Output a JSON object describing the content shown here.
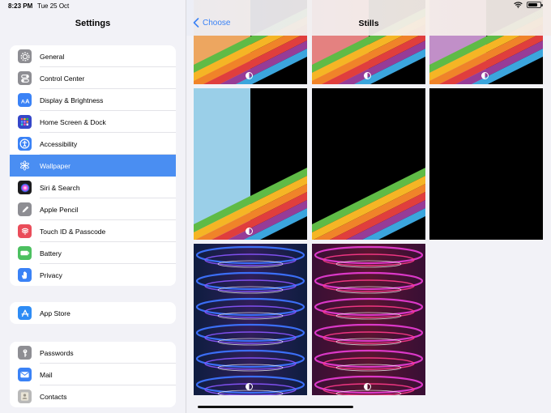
{
  "status_bar": {
    "time": "8:23 PM",
    "date": "Tue 25 Oct",
    "battery_level": 0.75
  },
  "sidebar": {
    "title": "Settings",
    "group1": [
      {
        "label": "General",
        "icon": "gear-icon",
        "color": "#8e8e93"
      },
      {
        "label": "Control Center",
        "icon": "switches-icon",
        "color": "#8e8e93"
      },
      {
        "label": "Display & Brightness",
        "icon": "text-size-icon",
        "color": "#3a82f6"
      },
      {
        "label": "Home Screen & Dock",
        "icon": "app-grid-icon",
        "color": "#3547c9"
      },
      {
        "label": "Accessibility",
        "icon": "accessibility-person-icon",
        "color": "#3a82f6"
      },
      {
        "label": "Wallpaper",
        "icon": "flower-icon",
        "color": "#4a8ef2",
        "selected": true
      },
      {
        "label": "Siri & Search",
        "icon": "siri-icon",
        "color": "#1c1c1e"
      },
      {
        "label": "Apple Pencil",
        "icon": "pencil-icon",
        "color": "#8e8e93"
      },
      {
        "label": "Touch ID & Passcode",
        "icon": "fingerprint-icon",
        "color": "#ea4d5a"
      },
      {
        "label": "Battery",
        "icon": "battery-icon",
        "color": "#4cc060"
      },
      {
        "label": "Privacy",
        "icon": "hand-icon",
        "color": "#3a82f6"
      }
    ],
    "group2": [
      {
        "label": "App Store",
        "icon": "app-store-icon",
        "color": "#2e8cf5"
      }
    ],
    "group3": [
      {
        "label": "Passwords",
        "icon": "key-icon",
        "color": "#8e8e93"
      },
      {
        "label": "Mail",
        "icon": "envelope-icon",
        "color": "#3a82f6"
      },
      {
        "label": "Contacts",
        "icon": "contacts-icon",
        "color": "#b9b9b9"
      }
    ]
  },
  "detail": {
    "back_label": "Choose",
    "title": "Stills",
    "accent": "#3a82f6",
    "wallpapers": [
      {
        "name": "Classic Stripes Orange",
        "style": "stripes",
        "bg": "#eda660",
        "appearance_toggle": true
      },
      {
        "name": "Classic Stripes Pink",
        "style": "stripes",
        "bg": "#e48180",
        "appearance_toggle": true
      },
      {
        "name": "Classic Stripes Purple",
        "style": "stripes",
        "bg": "#c18fc8",
        "appearance_toggle": true
      },
      {
        "name": "Classic Stripes Blue",
        "style": "stripes",
        "bg": "#9acfe8",
        "appearance_toggle": true
      },
      {
        "name": "Classic Stripes Black",
        "style": "stripes",
        "bg": "#000000",
        "appearance_toggle": false
      },
      {
        "name": "Black",
        "style": "solid",
        "bg": "#000000",
        "appearance_toggle": false
      },
      {
        "name": "Light Rings Blue",
        "style": "rings",
        "bg": "#000000",
        "colors": [
          "#3d73ff",
          "#8a55ff"
        ],
        "appearance_toggle": true
      },
      {
        "name": "Light Rings Pink",
        "style": "rings",
        "bg": "#000000",
        "colors": [
          "#e33bd0",
          "#ff3a8a"
        ],
        "appearance_toggle": true
      }
    ]
  }
}
